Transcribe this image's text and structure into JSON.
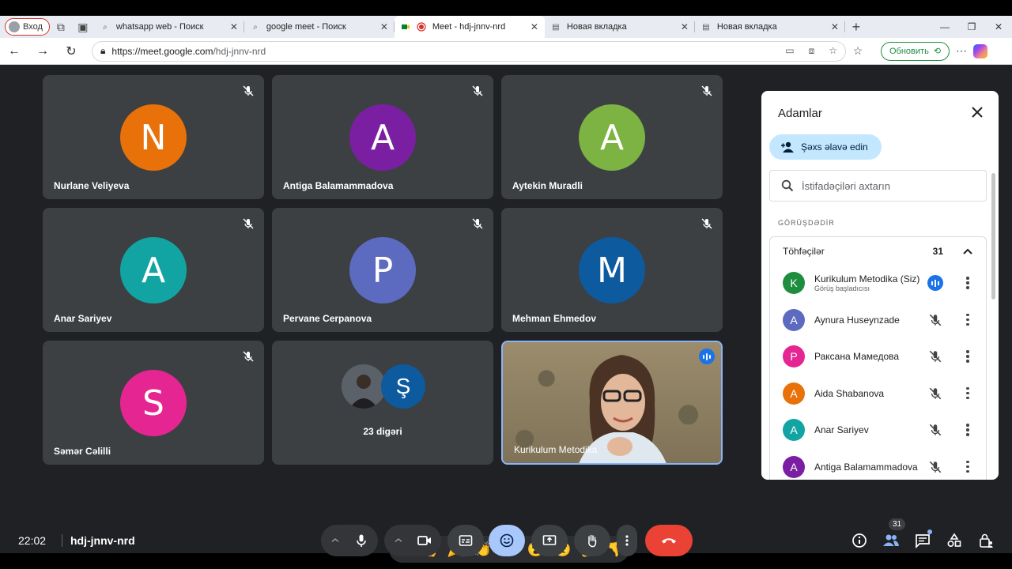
{
  "browser": {
    "profile_label": "Вход",
    "tabs": [
      {
        "title": "whatsapp web - Поиск",
        "icon": "search-icon"
      },
      {
        "title": "google meet - Поиск",
        "icon": "search-icon"
      },
      {
        "title": "Meet - hdj-jnnv-nrd",
        "icon": "meet-icon",
        "active": true
      },
      {
        "title": "Новая вкладка",
        "icon": "newtab-icon"
      },
      {
        "title": "Новая вкладка",
        "icon": "newtab-icon"
      }
    ],
    "url_host": "https://meet.google.com",
    "url_path": "/hdj-jnnv-nrd",
    "update_label": "Обновить"
  },
  "grid": {
    "tiles": [
      {
        "name": "Nurlane Veliyeva",
        "initial": "N",
        "color": "#e8710a"
      },
      {
        "name": "Antiga Balamammadova",
        "initial": "A",
        "color": "#7b1fa2"
      },
      {
        "name": "Aytekin Muradli",
        "initial": "A",
        "color": "#7cb342"
      },
      {
        "name": "Anar Sariyev",
        "initial": "A",
        "color": "#12a4a3"
      },
      {
        "name": "Pervane Cerpanova",
        "initial": "P",
        "color": "#5c6bc0"
      },
      {
        "name": "Mehman Ehmedov",
        "initial": "M",
        "color": "#0d5a9e"
      },
      {
        "name": "Səmər Cəlilli",
        "initial": "S",
        "color": "#e52592"
      }
    ],
    "others": {
      "label": "23 digəri",
      "initial": "Ş",
      "color": "#0d5a9e"
    },
    "self": {
      "name": "Kurikulum Metodika"
    }
  },
  "reactions": [
    "💖",
    "👍",
    "🎉",
    "👏",
    "😂",
    "😮",
    "😢",
    "🤔",
    "👎"
  ],
  "bottom": {
    "time": "22:02",
    "meeting_code": "hdj-jnnv-nrd",
    "people_count": "31"
  },
  "panel": {
    "title": "Adamlar",
    "add_label": "Şəxs əlavə edin",
    "search_placeholder": "İstifadəçiləri axtarın",
    "section_label": "GÖRÜŞDƏDİR",
    "group_label": "Töhfəçilər",
    "group_count": "31",
    "participants": [
      {
        "name": "Kurikulum Metodika (Siz)",
        "sub": "Görüş başladıcısı",
        "initial": "K",
        "color": "#1e8e3e",
        "speaking": true
      },
      {
        "name": "Aynura Huseynzade",
        "initial": "A",
        "color": "#5c6bc0"
      },
      {
        "name": "Раксана Мамедова",
        "initial": "P",
        "color": "#e52592"
      },
      {
        "name": "Aida Shabanova",
        "initial": "A",
        "color": "#e8710a"
      },
      {
        "name": "Anar Sariyev",
        "initial": "A",
        "color": "#12a4a3"
      },
      {
        "name": "Antiga Balamammadova",
        "initial": "A",
        "color": "#7b1fa2"
      }
    ]
  }
}
